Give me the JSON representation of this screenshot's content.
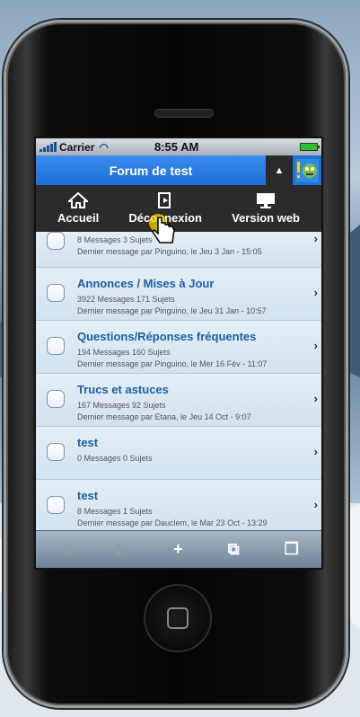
{
  "statusbar": {
    "carrier": "Carrier",
    "time": "8:55 AM"
  },
  "header": {
    "title": "Forum de test",
    "toggle": "▲"
  },
  "menu": {
    "home": "Accueil",
    "logout": "Déconnexion",
    "web": "Version web"
  },
  "forums": [
    {
      "title": "",
      "stats": "8 Messages 3 Sujets",
      "last": "Dernier message par Pinguino, le Jeu 3 Jan - 15:05"
    },
    {
      "title": "Annonces / Mises à Jour",
      "stats": "3922 Messages 171 Sujets",
      "last": "Dernier message par Pinguino, le Jeu 31 Jan - 10:57"
    },
    {
      "title": "Questions/Réponses fréquentes",
      "stats": "194 Messages 160 Sujets",
      "last": "Dernier message par Pinguino, le Mer 16 Fév - 11:07"
    },
    {
      "title": "Trucs et astuces",
      "stats": "167 Messages 92 Sujets",
      "last": "Dernier message par Etana, le Jeu 14 Oct - 9:07"
    },
    {
      "title": "test",
      "stats": "0 Messages 0 Sujets",
      "last": ""
    },
    {
      "title": "test",
      "stats": "8 Messages 1 Sujets",
      "last": "Dernier message par Dauclem, le Mar 23 Oct - 13:29"
    }
  ]
}
